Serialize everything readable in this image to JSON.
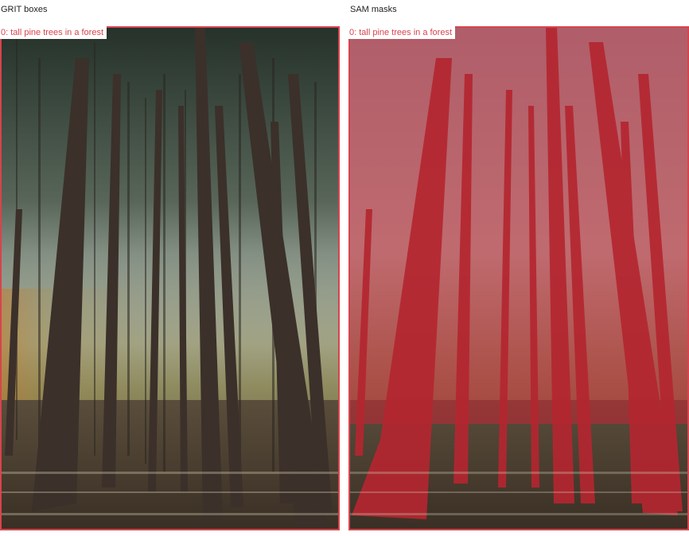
{
  "panels": {
    "left": {
      "title": "GRIT boxes",
      "box_label": "0: tall pine trees in a forest"
    },
    "right": {
      "title": "SAM masks",
      "box_label": "0: tall pine trees in a forest"
    }
  },
  "colors": {
    "box_outline": "#d7444d",
    "label_text": "#d7444d",
    "mask_fill": "#c8303a"
  }
}
